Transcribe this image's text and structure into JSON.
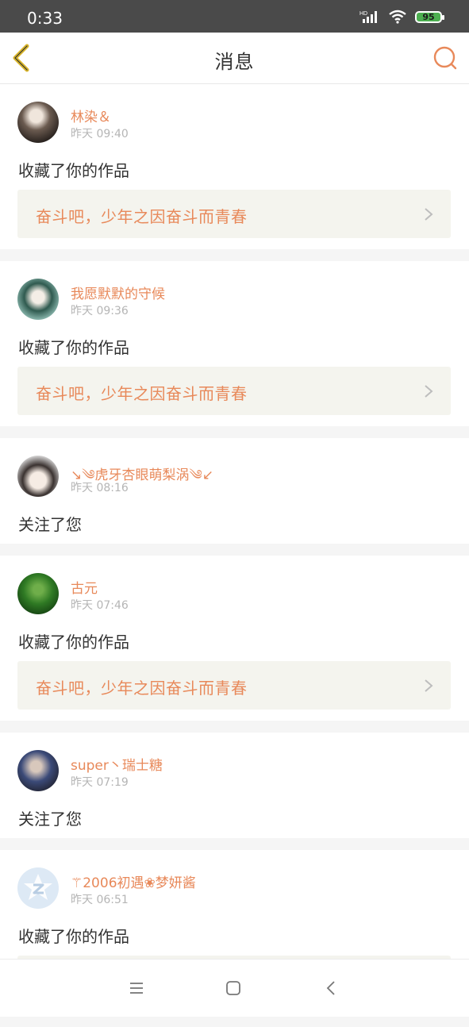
{
  "status_bar": {
    "time": "0:33",
    "network": "HD",
    "battery": "95"
  },
  "header": {
    "title": "消息"
  },
  "colors": {
    "accent": "#e8895a",
    "back_arrow": "#d9b52a",
    "card_link_bg": "#f4f4ee"
  },
  "notifications": [
    {
      "user": "林染＆",
      "time": "昨天 09:40",
      "action": "收藏了你的作品",
      "work_title": "奋斗吧，少年之因奋斗而青春"
    },
    {
      "user": "我愿默默的守候",
      "time": "昨天 09:36",
      "action": "收藏了你的作品",
      "work_title": "奋斗吧，少年之因奋斗而青春"
    },
    {
      "user": "↘༄虎牙杏眼萌梨涡༄↙",
      "time": "昨天 08:16",
      "action": "关注了您"
    },
    {
      "user": "古元",
      "time": "昨天 07:46",
      "action": "收藏了你的作品",
      "work_title": "奋斗吧，少年之因奋斗而青春"
    },
    {
      "user": "super丶瑞士糖",
      "time": "昨天 07:19",
      "action": "关注了您"
    },
    {
      "user": "⚚2006初遇❀梦妍酱",
      "time": "昨天 06:51",
      "action": "收藏了你的作品"
    }
  ],
  "system_nav": {
    "menu_icon": "menu-icon",
    "home_icon": "home-icon",
    "back_icon": "back-icon"
  }
}
